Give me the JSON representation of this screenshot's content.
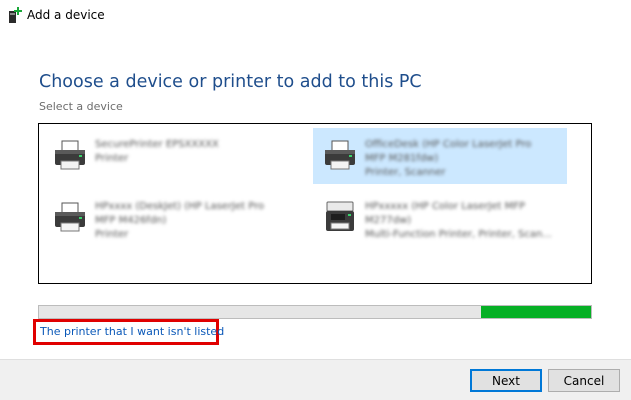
{
  "window": {
    "title": "Add a device"
  },
  "page": {
    "heading": "Choose a device or printer to add to this PC",
    "subheading": "Select a device"
  },
  "devices": [
    {
      "line1": "SecurePrinter EPSXXXXX",
      "line2": "Printer",
      "line3": "",
      "icon": "printer-icon",
      "selected": false
    },
    {
      "line1": "OfficeDesk (HP Color LaserJet Pro",
      "line2": "MFP M281fdw)",
      "line3": "Printer, Scanner",
      "icon": "printer-icon",
      "selected": true
    },
    {
      "line1": "HPxxxx (DeskJet) (HP LaserJet Pro",
      "line2": "MFP M426fdn)",
      "line3": "Printer",
      "icon": "printer-icon",
      "selected": false
    },
    {
      "line1": "HPxxxxx (HP Color LaserJet MFP",
      "line2": "M277dw)",
      "line3": "Multi-Function Printer, Printer, Scan...",
      "icon": "mfp-printer-icon",
      "selected": false
    }
  ],
  "progress": {
    "percent": 20,
    "color": "#06b025"
  },
  "link": {
    "text": "The printer that I want isn't listed"
  },
  "buttons": {
    "next": "Next",
    "cancel": "Cancel"
  },
  "colors": {
    "heading": "#1f4e8c",
    "link": "#0a58b8",
    "selection": "#cce8ff",
    "highlight": "#e00000"
  }
}
